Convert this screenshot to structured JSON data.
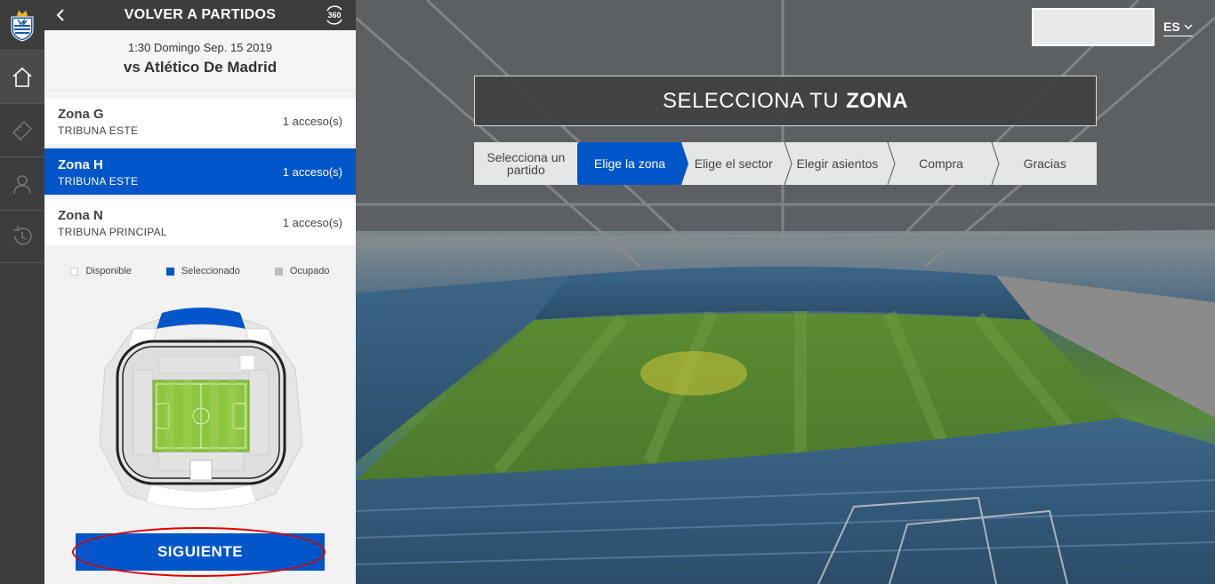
{
  "header": {
    "back_title": "VOLVER A PARTIDOS",
    "view_360_label": "360"
  },
  "match": {
    "datetime": "1:30 Domingo Sep. 15 2019",
    "opponent": "vs Atlético De Madrid"
  },
  "zones": [
    {
      "name": "Zona G",
      "stand": "TRIBUNA ESTE",
      "access": "1 acceso(s)",
      "selected": false
    },
    {
      "name": "Zona H",
      "stand": "TRIBUNA ESTE",
      "access": "1 acceso(s)",
      "selected": true
    },
    {
      "name": "Zona N",
      "stand": "TRIBUNA PRINCIPAL",
      "access": "1 acceso(s)",
      "selected": false
    }
  ],
  "legend": {
    "available": "Disponible",
    "selected": "Seleccionado",
    "occupied": "Ocupado"
  },
  "next_button": "SIGUIENTE",
  "main": {
    "title_prefix": "SELECCIONA TU",
    "title_bold": "ZONA",
    "language": "ES",
    "steps": [
      {
        "label": "Selecciona un partido",
        "active": false
      },
      {
        "label": "Elige la zona",
        "active": true
      },
      {
        "label": "Elige el sector",
        "active": false
      },
      {
        "label": "Elegir asientos",
        "active": false
      },
      {
        "label": "Compra",
        "active": false
      },
      {
        "label": "Gracias",
        "active": false
      }
    ]
  },
  "colors": {
    "accent": "#0056c8",
    "dark": "#3d3d3d",
    "highlight_ring": "#e00000",
    "available_swatch": "#ffffff",
    "occupied_swatch": "#bdbdbd"
  },
  "icons": {
    "logo": "real-sociedad-crest",
    "nav": [
      "home-icon",
      "ticket-icon",
      "user-icon",
      "history-icon"
    ]
  }
}
